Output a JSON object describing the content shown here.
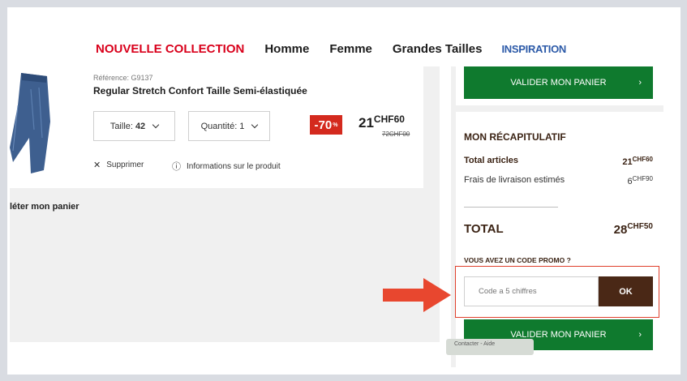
{
  "nav": {
    "items": [
      "NOUVELLE COLLECTION",
      "Homme",
      "Femme",
      "Grandes Tailles",
      "INSPIRATION"
    ]
  },
  "product": {
    "reference": "Référence: G9137",
    "name": "Regular Stretch Confort Taille Semi-élastiquée",
    "size_label": "Taille:",
    "size_value": "42",
    "quantity_label": "Quantité:",
    "quantity_value": "1",
    "discount": "-70",
    "discount_unit": "%",
    "price_int": "21",
    "price_dec": "CHF60",
    "old_price": "72CHF00",
    "remove_label": "Supprimer",
    "info_label": "Informations sur le produit",
    "image_icon": "jeans-image"
  },
  "back_link": "léter mon panier",
  "summary": {
    "validate_label": "VALIDER MON PANIER",
    "title": "MON RÉCAPITULATIF",
    "total_articles_label": "Total articles",
    "total_articles_int": "21",
    "total_articles_dec": "CHF60",
    "shipping_label": "Frais de livraison estimés",
    "shipping_int": "6",
    "shipping_dec": "CHF90",
    "total_label": "TOTAL",
    "total_int": "28",
    "total_dec": "CHF50",
    "promo_question": "VOUS AVEZ UN CODE PROMO ?",
    "promo_placeholder": "Code a 5 chiffres",
    "promo_button": "OK",
    "validate_label_bottom": "VALIDER MON PANIER",
    "tooltip_text": "Contacter - Aide"
  },
  "colors": {
    "brand_red": "#d9001b",
    "green": "#0f7a2e",
    "brown": "#4a2816",
    "highlight": "#e0402c"
  }
}
